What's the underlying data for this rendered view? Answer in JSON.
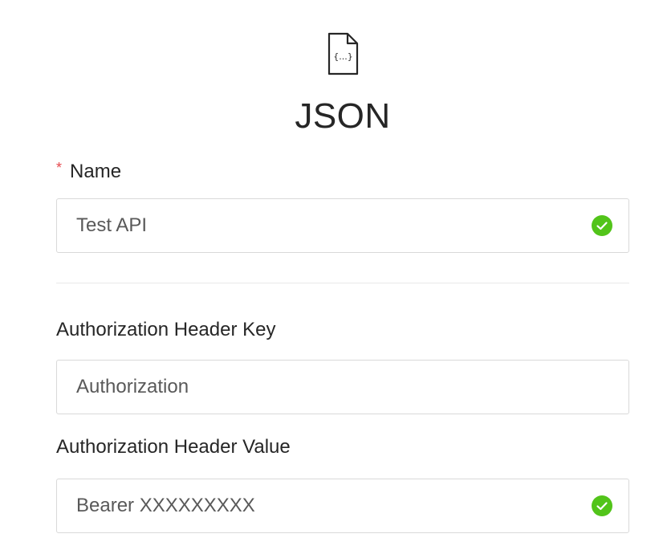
{
  "header": {
    "icon": "json-file-icon",
    "title": "JSON"
  },
  "form": {
    "name": {
      "required_mark": "*",
      "label": "Name",
      "value": "Test API",
      "valid": true
    },
    "auth_key": {
      "label": "Authorization Header Key",
      "value": "Authorization"
    },
    "auth_value": {
      "label": "Authorization Header Value",
      "value": "Bearer XXXXXXXXX",
      "valid": true
    }
  },
  "colors": {
    "success": "#52c41a",
    "required": "#e5484d",
    "border": "#d9d9d9"
  }
}
